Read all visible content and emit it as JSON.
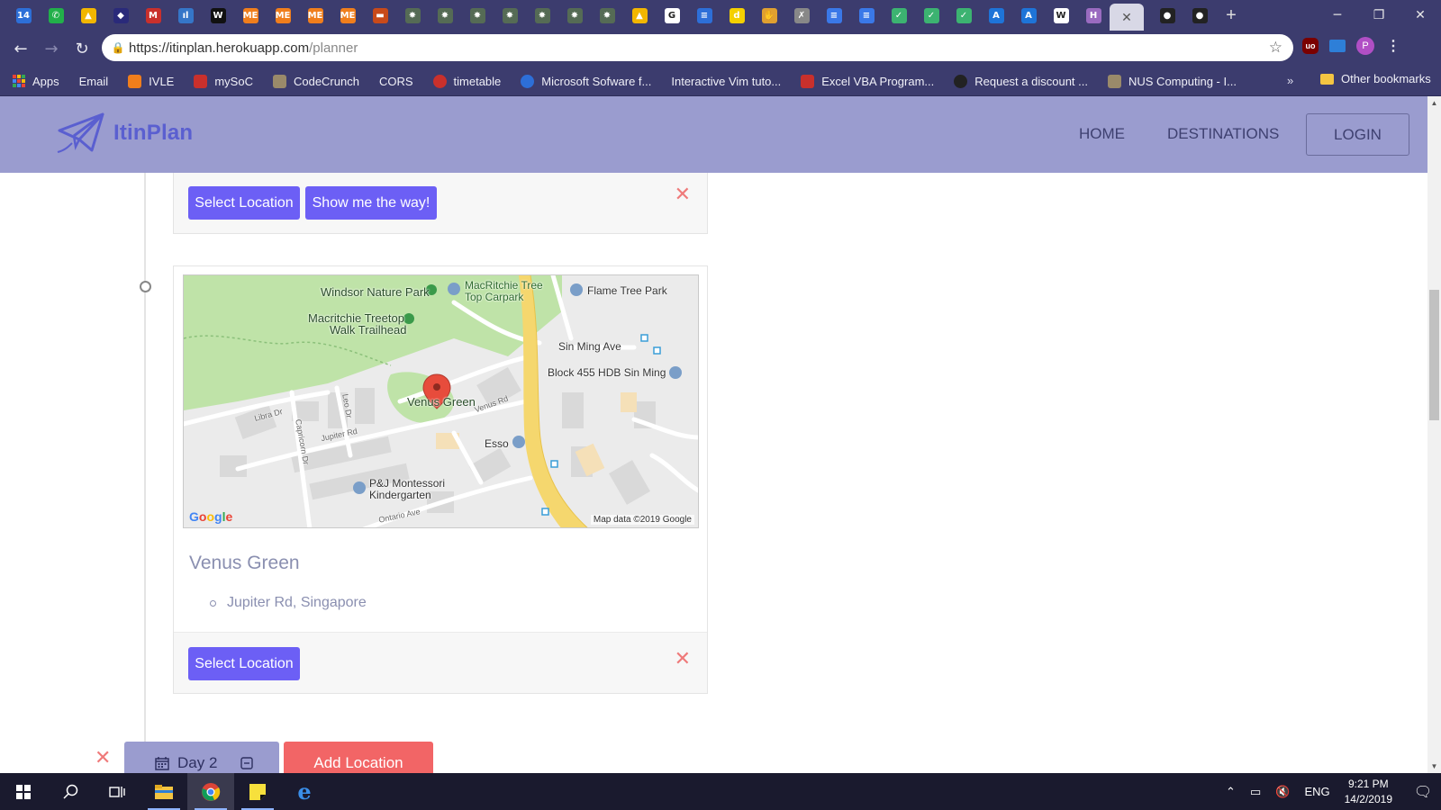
{
  "browser": {
    "url_host": "https://itinplan.herokuapp.com",
    "url_path": "/planner",
    "tab_close_glyph": "✕",
    "new_tab_glyph": "+",
    "tab_icons": [
      {
        "name": "calendar-icon",
        "glyph": "14",
        "color": "#2d6fd8"
      },
      {
        "name": "whatsapp-icon",
        "glyph": "✆",
        "color": "#22b04a"
      },
      {
        "name": "drive-icon",
        "glyph": "▲",
        "color": "#f2b600"
      },
      {
        "name": "game-icon",
        "glyph": "◆",
        "color": "#2a2a7a"
      },
      {
        "name": "gmail-icon",
        "glyph": "M",
        "color": "#c9302c"
      },
      {
        "name": "analytics-icon",
        "glyph": "ıl",
        "color": "#3576c8"
      },
      {
        "name": "w-icon",
        "glyph": "W",
        "color": "#111111"
      },
      {
        "name": "me-icon",
        "glyph": "ME",
        "color": "#f07e1c"
      },
      {
        "name": "me-icon",
        "glyph": "ME",
        "color": "#f07e1c"
      },
      {
        "name": "me-icon",
        "glyph": "ME",
        "color": "#f07e1c"
      },
      {
        "name": "me-icon",
        "glyph": "ME",
        "color": "#f07e1c"
      },
      {
        "name": "bars-icon",
        "glyph": "▬",
        "color": "#c84a1a"
      },
      {
        "name": "puzzle-icon",
        "glyph": "✸",
        "color": "#556b55"
      },
      {
        "name": "puzzle-icon",
        "glyph": "✸",
        "color": "#556b55"
      },
      {
        "name": "puzzle-icon",
        "glyph": "✸",
        "color": "#556b55"
      },
      {
        "name": "puzzle-icon",
        "glyph": "✸",
        "color": "#556b55"
      },
      {
        "name": "puzzle-icon",
        "glyph": "✸",
        "color": "#556b55"
      },
      {
        "name": "puzzle-icon",
        "glyph": "✸",
        "color": "#556b55"
      },
      {
        "name": "puzzle-icon",
        "glyph": "✸",
        "color": "#556b55"
      },
      {
        "name": "drive-icon",
        "glyph": "▲",
        "color": "#f2b600"
      },
      {
        "name": "google-icon",
        "glyph": "G",
        "color": "#ffffff"
      },
      {
        "name": "list-icon",
        "glyph": "≡",
        "color": "#2d6fd8"
      },
      {
        "name": "d-icon",
        "glyph": "d",
        "color": "#f4d000"
      },
      {
        "name": "hand-icon",
        "glyph": "✋",
        "color": "#e0a030"
      },
      {
        "name": "pen-icon",
        "glyph": "✗",
        "color": "#888888"
      },
      {
        "name": "docs-icon",
        "glyph": "≡",
        "color": "#3a78e8"
      },
      {
        "name": "docs-icon",
        "glyph": "≡",
        "color": "#3a78e8"
      },
      {
        "name": "check-icon",
        "glyph": "✓",
        "color": "#3cb371"
      },
      {
        "name": "check-icon",
        "glyph": "✓",
        "color": "#3cb371"
      },
      {
        "name": "check-icon",
        "glyph": "✓",
        "color": "#3cb371"
      },
      {
        "name": "azure-icon",
        "glyph": "A",
        "color": "#1e74d8"
      },
      {
        "name": "azure-icon",
        "glyph": "A",
        "color": "#1e74d8"
      },
      {
        "name": "wikipedia-icon",
        "glyph": "W",
        "color": "#ffffff"
      },
      {
        "name": "h-icon",
        "glyph": "H",
        "color": "#9a6bc0"
      }
    ],
    "tab_icons_after": [
      {
        "name": "github-icon",
        "glyph": "●",
        "color": "#222222"
      },
      {
        "name": "github-icon",
        "glyph": "●",
        "color": "#222222"
      }
    ],
    "bookmarks": [
      {
        "name": "bookmark-apps",
        "icon": "apps-grid-icon",
        "label": "Apps"
      },
      {
        "name": "bookmark-email",
        "icon": "page-icon",
        "label": "Email"
      },
      {
        "name": "bookmark-ivle",
        "icon": "me-icon",
        "label": "IVLE"
      },
      {
        "name": "bookmark-mysoc",
        "icon": "nus-icon",
        "label": "mySoC"
      },
      {
        "name": "bookmark-codecrunch",
        "icon": "shield-icon",
        "label": "CodeCrunch"
      },
      {
        "name": "bookmark-cors",
        "icon": "page-icon",
        "label": "CORS"
      },
      {
        "name": "bookmark-timetable",
        "icon": "m-circle-icon",
        "label": "timetable"
      },
      {
        "name": "bookmark-microsoft",
        "icon": "otm-icon",
        "label": "Microsoft Sofware f..."
      },
      {
        "name": "bookmark-vim",
        "icon": "page-icon",
        "label": "Interactive Vim tuto..."
      },
      {
        "name": "bookmark-excel",
        "icon": "hl-icon",
        "label": "Excel VBA Program..."
      },
      {
        "name": "bookmark-discount",
        "icon": "github-icon",
        "label": "Request a discount ..."
      },
      {
        "name": "bookmark-nus",
        "icon": "shield-icon",
        "label": "NUS Computing - I..."
      }
    ],
    "bookmarks_more": "»",
    "other_bookmarks": "Other bookmarks"
  },
  "colors": {
    "navbar": "#9a9ccf",
    "primary_button": "#6c5ff5",
    "add_button": "#f26566",
    "close_x": "#ef7a7a",
    "muted_text": "#8a8fb0"
  },
  "navbar": {
    "brand": "ItinPlan",
    "links": [
      "HOME",
      "DESTINATIONS"
    ],
    "login": "LOGIN"
  },
  "cards": [
    {
      "buttons": [
        "Select Location",
        "Show me the way!"
      ]
    },
    {
      "place_name": "Venus Green",
      "address": "Jupiter Rd, Singapore",
      "buttons": [
        "Select Location"
      ],
      "map": {
        "labels": {
          "windsor": "Windsor Nature Park",
          "macritchie_carpark_1": "MacRitchie Tree",
          "macritchie_carpark_2": "Top Carpark",
          "flame_tree": "Flame Tree Park",
          "treetop_1": "Macritchie Treetop",
          "treetop_2": "Walk Trailhead",
          "sin_ming_ave": "Sin Ming Ave",
          "block455": "Block 455 HDB Sin Ming",
          "venus_green": "Venus Green",
          "venus_rd": "Venus Rd",
          "libra_dr": "Libra Dr",
          "leo_dr": "Leo Dr",
          "jupiter_rd": "Jupiter Rd",
          "capricorn_dr": "Capricorn Dr",
          "esso": "Esso",
          "pj_1": "P&J Montessori",
          "pj_2": "Kindergarten",
          "ontario_ave": "Ontario Ave"
        },
        "attribution": "Map data ©2019 Google",
        "google_letters": [
          "G",
          "o",
          "o",
          "g",
          "l",
          "e"
        ]
      }
    }
  ],
  "day_bar": {
    "day_label": "Day 2",
    "add_location": "Add Location"
  },
  "taskbar": {
    "language": "ENG",
    "time": "9:21 PM",
    "date": "14/2/2019"
  }
}
